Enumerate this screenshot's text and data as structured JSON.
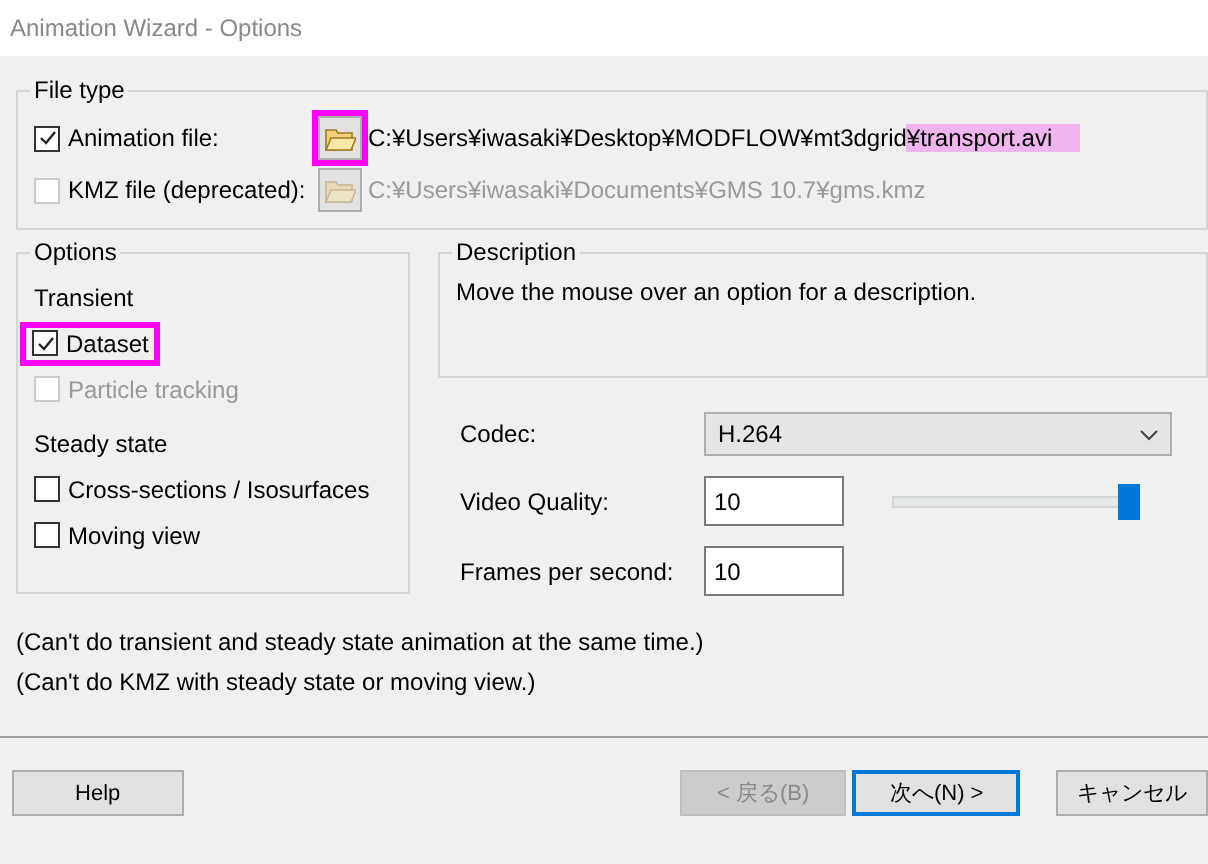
{
  "window": {
    "title": "Animation Wizard - Options"
  },
  "file_type": {
    "title": "File type",
    "rows": [
      {
        "label": "Animation file:",
        "checked": true,
        "disabled": false,
        "browse_highlighted": true,
        "path_parts": [
          {
            "text": "C:¥Users¥iwasaki¥Desktop¥MODFLOW¥mt3dgrid",
            "highlighted": false
          },
          {
            "text": "¥transport.avi",
            "highlighted": true
          }
        ]
      },
      {
        "label": "KMZ file (deprecated):",
        "checked": false,
        "disabled": true,
        "browse_highlighted": false,
        "path_parts": [
          {
            "text": "C:¥Users¥iwasaki¥Documents¥GMS 10.7¥gms.kmz",
            "highlighted": false
          }
        ]
      }
    ]
  },
  "options": {
    "title": "Options",
    "items": [
      {
        "kind": "heading",
        "label": "Transient"
      },
      {
        "kind": "checkbox",
        "label": "Dataset",
        "checked": true,
        "disabled": false,
        "highlighted": true
      },
      {
        "kind": "checkbox",
        "label": "Particle tracking",
        "checked": false,
        "disabled": true,
        "highlighted": false
      },
      {
        "kind": "heading",
        "label": "Steady state"
      },
      {
        "kind": "checkbox",
        "label": "Cross-sections / Isosurfaces",
        "checked": false,
        "disabled": false,
        "highlighted": false
      },
      {
        "kind": "checkbox",
        "label": "Moving view",
        "checked": false,
        "disabled": false,
        "highlighted": false
      }
    ]
  },
  "description": {
    "title": "Description",
    "text": "Move the mouse over an option for a description."
  },
  "settings": [
    {
      "kind": "dropdown",
      "label": "Codec:",
      "value": "H.264"
    },
    {
      "kind": "slider",
      "label": "Video Quality:",
      "value": "10",
      "level": 1.0
    },
    {
      "kind": "input",
      "label": "Frames per second:",
      "value": "10"
    }
  ],
  "notes": [
    "(Can't do transient and steady state animation at the same time.)",
    "(Can't do KMZ with steady state or moving view.)"
  ],
  "buttons": [
    {
      "label": "Help",
      "kind": "help",
      "disabled": false,
      "default": false
    },
    {
      "label": "< 戻る(B)",
      "kind": "nav",
      "disabled": true,
      "default": false
    },
    {
      "label": "次へ(N) >",
      "kind": "nav",
      "disabled": false,
      "default": true
    },
    {
      "label": "キャンセル",
      "kind": "cancel",
      "disabled": false,
      "default": false
    }
  ]
}
